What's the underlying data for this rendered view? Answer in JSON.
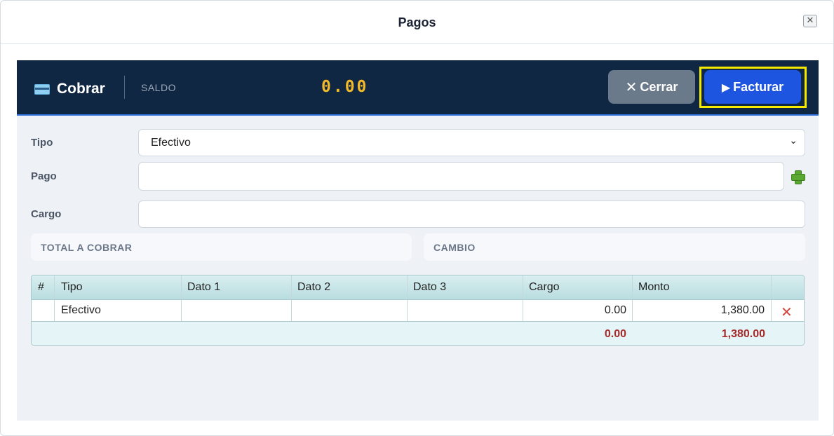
{
  "dialog": {
    "title": "Pagos",
    "close_glyph": "✕"
  },
  "header": {
    "title": "Cobrar",
    "icon": "credit-card-icon",
    "saldo_label": "SALDO",
    "saldo_value": "0.00",
    "cerrar_label": "Cerrar",
    "facturar_label": "Facturar"
  },
  "form": {
    "tipo_label": "Tipo",
    "tipo_value": "Efectivo",
    "pago_label": "Pago",
    "pago_value": "",
    "cargo_label": "Cargo",
    "cargo_value": "",
    "total_label": "TOTAL A COBRAR",
    "cambio_label": "CAMBIO"
  },
  "table": {
    "columns": [
      "#",
      "Tipo",
      "Dato 1",
      "Dato 2",
      "Dato 3",
      "Cargo",
      "Monto"
    ],
    "rows": [
      {
        "num": "",
        "tipo": "Efectivo",
        "dato1": "",
        "dato2": "",
        "dato3": "",
        "cargo": "0.00",
        "monto": "1,380.00"
      }
    ],
    "totals": {
      "cargo": "0.00",
      "monto": "1,380.00"
    }
  },
  "colors": {
    "accent": "#1e55e0",
    "bar_bg": "#102744",
    "saldo": "#f2b928",
    "highlight": "#f5e900",
    "total_text": "#a52a2a"
  }
}
